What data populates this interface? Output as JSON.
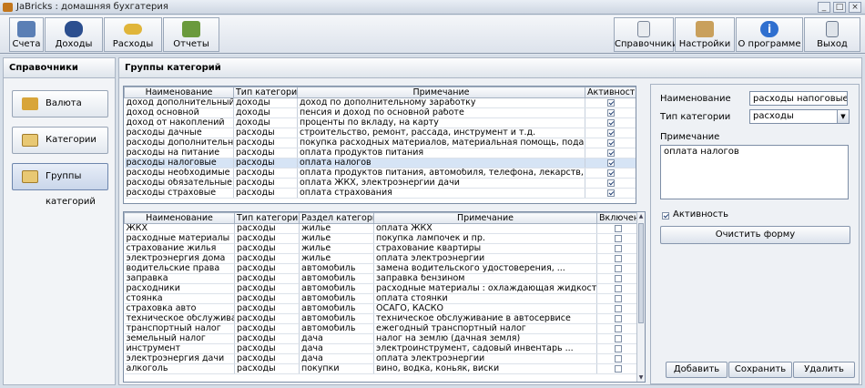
{
  "window": {
    "title": "JaBricks : домашняя бухгатерия"
  },
  "toolbar": {
    "left": [
      {
        "label": "Счета",
        "icon": "accounts-icon"
      },
      {
        "label": "Доходы",
        "icon": "income-icon"
      },
      {
        "label": "Расходы",
        "icon": "expenses-icon"
      },
      {
        "label": "Отчеты",
        "icon": "reports-icon"
      }
    ],
    "right": [
      {
        "label": "Справочники",
        "icon": "directories-icon"
      },
      {
        "label": "Настройки",
        "icon": "settings-icon"
      },
      {
        "label": "О программе",
        "icon": "info-icon"
      },
      {
        "label": "Выход",
        "icon": "exit-icon"
      }
    ]
  },
  "sidebar": {
    "title": "Справочники",
    "items": [
      {
        "label": "Валюта",
        "icon": "currency-icon"
      },
      {
        "label": "Категории",
        "icon": "categories-icon"
      },
      {
        "label": "Группы категорий",
        "icon": "category-groups-icon"
      }
    ]
  },
  "content": {
    "title": "Группы категорий"
  },
  "top_grid": {
    "columns": [
      "Наименование",
      "Тип категории",
      "Примечание",
      "Активность"
    ],
    "rows": [
      [
        "доход дополнительный",
        "доходы",
        "доход по дополнительному заработку",
        true
      ],
      [
        "доход основной",
        "доходы",
        "пенсия и доход по основной работе",
        true
      ],
      [
        "доход от накоплений",
        "доходы",
        "проценты по вкладу, на карту",
        true
      ],
      [
        "расходы дачные",
        "расходы",
        "строительство, ремонт, рассада, инструмент и т.д.",
        true
      ],
      [
        "расходы дополнительные",
        "расходы",
        "покупка расходных материалов, материальная помощь, подарки",
        true
      ],
      [
        "расходы на питание",
        "расходы",
        "оплата продуктов питания",
        true
      ],
      [
        "расходы налоговые",
        "расходы",
        "оплата налогов",
        true
      ],
      [
        "расходы необходимые",
        "расходы",
        "оплата продуктов питания, автомобиля, телефона, лекарств, медицина",
        true
      ],
      [
        "расходы обязательные",
        "расходы",
        "оплата ЖКХ, электроэнергии дачи",
        true
      ],
      [
        "расходы страховые",
        "расходы",
        "оплата  страхования",
        true
      ]
    ],
    "selected_index": 6
  },
  "bottom_grid": {
    "columns": [
      "Наименование",
      "Тип категории",
      "Раздел категории",
      "Примечание",
      "Включение"
    ],
    "rows": [
      [
        "ЖКХ",
        "расходы",
        "жилье",
        "оплата ЖКХ"
      ],
      [
        "расходные материалы",
        "расходы",
        "жилье",
        "покупка лампочек и пр."
      ],
      [
        "страхование жилья",
        "расходы",
        "жилье",
        "страхование квартиры"
      ],
      [
        "электроэнергия дома",
        "расходы",
        "жилье",
        "оплата электроэнергии"
      ],
      [
        "водительские права",
        "расходы",
        "автомобиль",
        "замена водительского удостоверения, ..."
      ],
      [
        "заправка",
        "расходы",
        "автомобиль",
        "заправка бензином"
      ],
      [
        "расходники",
        "расходы",
        "автомобиль",
        "расходные материалы : охлаждающая жидкость,..."
      ],
      [
        "стоянка",
        "расходы",
        "автомобиль",
        "оплата стоянки"
      ],
      [
        "страховка авто",
        "расходы",
        "автомобиль",
        "ОСАГО, КАСКО"
      ],
      [
        "техническое обслуживание",
        "расходы",
        "автомобиль",
        "техническое обслуживание в автосервисе"
      ],
      [
        "транспортный налог",
        "расходы",
        "автомобиль",
        "ежегодный транспортный налог"
      ],
      [
        "земельный налог",
        "расходы",
        "дача",
        "налог на землю (дачная земля)"
      ],
      [
        "инструмент",
        "расходы",
        "дача",
        "электроинструмент, садовый инвентарь ..."
      ],
      [
        "электроэнергия дачи",
        "расходы",
        "дача",
        "оплата электроэнергии"
      ],
      [
        "алкоголь",
        "расходы",
        "покупки",
        "вино, водка, коньяк, виски"
      ]
    ]
  },
  "form": {
    "name_label": "Наименование",
    "name_value": "расходы напоговые",
    "type_label": "Тип категории",
    "type_value": "расходы",
    "note_label": "Примечание",
    "note_value": "оплата налогов",
    "active_label": "Активность",
    "active_checked": true,
    "clear_button": "Очистить форму",
    "add_button": "Добавить",
    "save_button": "Сохранить",
    "delete_button": "Удалить"
  },
  "colors": {
    "selected_row": "#d6e4f5",
    "panel": "#eef1f5",
    "border": "#7d8ea6"
  }
}
